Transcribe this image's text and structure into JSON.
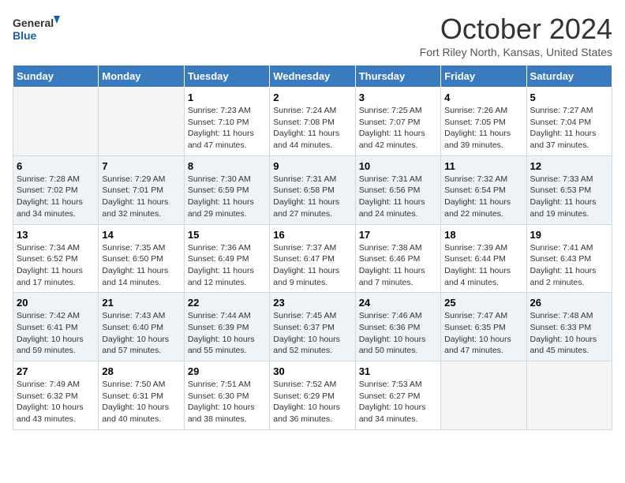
{
  "header": {
    "logo_line1": "General",
    "logo_line2": "Blue",
    "month": "October 2024",
    "location": "Fort Riley North, Kansas, United States"
  },
  "weekdays": [
    "Sunday",
    "Monday",
    "Tuesday",
    "Wednesday",
    "Thursday",
    "Friday",
    "Saturday"
  ],
  "weeks": [
    [
      {
        "day": "",
        "sunrise": "",
        "sunset": "",
        "daylight": ""
      },
      {
        "day": "",
        "sunrise": "",
        "sunset": "",
        "daylight": ""
      },
      {
        "day": "1",
        "sunrise": "Sunrise: 7:23 AM",
        "sunset": "Sunset: 7:10 PM",
        "daylight": "Daylight: 11 hours and 47 minutes."
      },
      {
        "day": "2",
        "sunrise": "Sunrise: 7:24 AM",
        "sunset": "Sunset: 7:08 PM",
        "daylight": "Daylight: 11 hours and 44 minutes."
      },
      {
        "day": "3",
        "sunrise": "Sunrise: 7:25 AM",
        "sunset": "Sunset: 7:07 PM",
        "daylight": "Daylight: 11 hours and 42 minutes."
      },
      {
        "day": "4",
        "sunrise": "Sunrise: 7:26 AM",
        "sunset": "Sunset: 7:05 PM",
        "daylight": "Daylight: 11 hours and 39 minutes."
      },
      {
        "day": "5",
        "sunrise": "Sunrise: 7:27 AM",
        "sunset": "Sunset: 7:04 PM",
        "daylight": "Daylight: 11 hours and 37 minutes."
      }
    ],
    [
      {
        "day": "6",
        "sunrise": "Sunrise: 7:28 AM",
        "sunset": "Sunset: 7:02 PM",
        "daylight": "Daylight: 11 hours and 34 minutes."
      },
      {
        "day": "7",
        "sunrise": "Sunrise: 7:29 AM",
        "sunset": "Sunset: 7:01 PM",
        "daylight": "Daylight: 11 hours and 32 minutes."
      },
      {
        "day": "8",
        "sunrise": "Sunrise: 7:30 AM",
        "sunset": "Sunset: 6:59 PM",
        "daylight": "Daylight: 11 hours and 29 minutes."
      },
      {
        "day": "9",
        "sunrise": "Sunrise: 7:31 AM",
        "sunset": "Sunset: 6:58 PM",
        "daylight": "Daylight: 11 hours and 27 minutes."
      },
      {
        "day": "10",
        "sunrise": "Sunrise: 7:31 AM",
        "sunset": "Sunset: 6:56 PM",
        "daylight": "Daylight: 11 hours and 24 minutes."
      },
      {
        "day": "11",
        "sunrise": "Sunrise: 7:32 AM",
        "sunset": "Sunset: 6:54 PM",
        "daylight": "Daylight: 11 hours and 22 minutes."
      },
      {
        "day": "12",
        "sunrise": "Sunrise: 7:33 AM",
        "sunset": "Sunset: 6:53 PM",
        "daylight": "Daylight: 11 hours and 19 minutes."
      }
    ],
    [
      {
        "day": "13",
        "sunrise": "Sunrise: 7:34 AM",
        "sunset": "Sunset: 6:52 PM",
        "daylight": "Daylight: 11 hours and 17 minutes."
      },
      {
        "day": "14",
        "sunrise": "Sunrise: 7:35 AM",
        "sunset": "Sunset: 6:50 PM",
        "daylight": "Daylight: 11 hours and 14 minutes."
      },
      {
        "day": "15",
        "sunrise": "Sunrise: 7:36 AM",
        "sunset": "Sunset: 6:49 PM",
        "daylight": "Daylight: 11 hours and 12 minutes."
      },
      {
        "day": "16",
        "sunrise": "Sunrise: 7:37 AM",
        "sunset": "Sunset: 6:47 PM",
        "daylight": "Daylight: 11 hours and 9 minutes."
      },
      {
        "day": "17",
        "sunrise": "Sunrise: 7:38 AM",
        "sunset": "Sunset: 6:46 PM",
        "daylight": "Daylight: 11 hours and 7 minutes."
      },
      {
        "day": "18",
        "sunrise": "Sunrise: 7:39 AM",
        "sunset": "Sunset: 6:44 PM",
        "daylight": "Daylight: 11 hours and 4 minutes."
      },
      {
        "day": "19",
        "sunrise": "Sunrise: 7:41 AM",
        "sunset": "Sunset: 6:43 PM",
        "daylight": "Daylight: 11 hours and 2 minutes."
      }
    ],
    [
      {
        "day": "20",
        "sunrise": "Sunrise: 7:42 AM",
        "sunset": "Sunset: 6:41 PM",
        "daylight": "Daylight: 10 hours and 59 minutes."
      },
      {
        "day": "21",
        "sunrise": "Sunrise: 7:43 AM",
        "sunset": "Sunset: 6:40 PM",
        "daylight": "Daylight: 10 hours and 57 minutes."
      },
      {
        "day": "22",
        "sunrise": "Sunrise: 7:44 AM",
        "sunset": "Sunset: 6:39 PM",
        "daylight": "Daylight: 10 hours and 55 minutes."
      },
      {
        "day": "23",
        "sunrise": "Sunrise: 7:45 AM",
        "sunset": "Sunset: 6:37 PM",
        "daylight": "Daylight: 10 hours and 52 minutes."
      },
      {
        "day": "24",
        "sunrise": "Sunrise: 7:46 AM",
        "sunset": "Sunset: 6:36 PM",
        "daylight": "Daylight: 10 hours and 50 minutes."
      },
      {
        "day": "25",
        "sunrise": "Sunrise: 7:47 AM",
        "sunset": "Sunset: 6:35 PM",
        "daylight": "Daylight: 10 hours and 47 minutes."
      },
      {
        "day": "26",
        "sunrise": "Sunrise: 7:48 AM",
        "sunset": "Sunset: 6:33 PM",
        "daylight": "Daylight: 10 hours and 45 minutes."
      }
    ],
    [
      {
        "day": "27",
        "sunrise": "Sunrise: 7:49 AM",
        "sunset": "Sunset: 6:32 PM",
        "daylight": "Daylight: 10 hours and 43 minutes."
      },
      {
        "day": "28",
        "sunrise": "Sunrise: 7:50 AM",
        "sunset": "Sunset: 6:31 PM",
        "daylight": "Daylight: 10 hours and 40 minutes."
      },
      {
        "day": "29",
        "sunrise": "Sunrise: 7:51 AM",
        "sunset": "Sunset: 6:30 PM",
        "daylight": "Daylight: 10 hours and 38 minutes."
      },
      {
        "day": "30",
        "sunrise": "Sunrise: 7:52 AM",
        "sunset": "Sunset: 6:29 PM",
        "daylight": "Daylight: 10 hours and 36 minutes."
      },
      {
        "day": "31",
        "sunrise": "Sunrise: 7:53 AM",
        "sunset": "Sunset: 6:27 PM",
        "daylight": "Daylight: 10 hours and 34 minutes."
      },
      {
        "day": "",
        "sunrise": "",
        "sunset": "",
        "daylight": ""
      },
      {
        "day": "",
        "sunrise": "",
        "sunset": "",
        "daylight": ""
      }
    ]
  ]
}
